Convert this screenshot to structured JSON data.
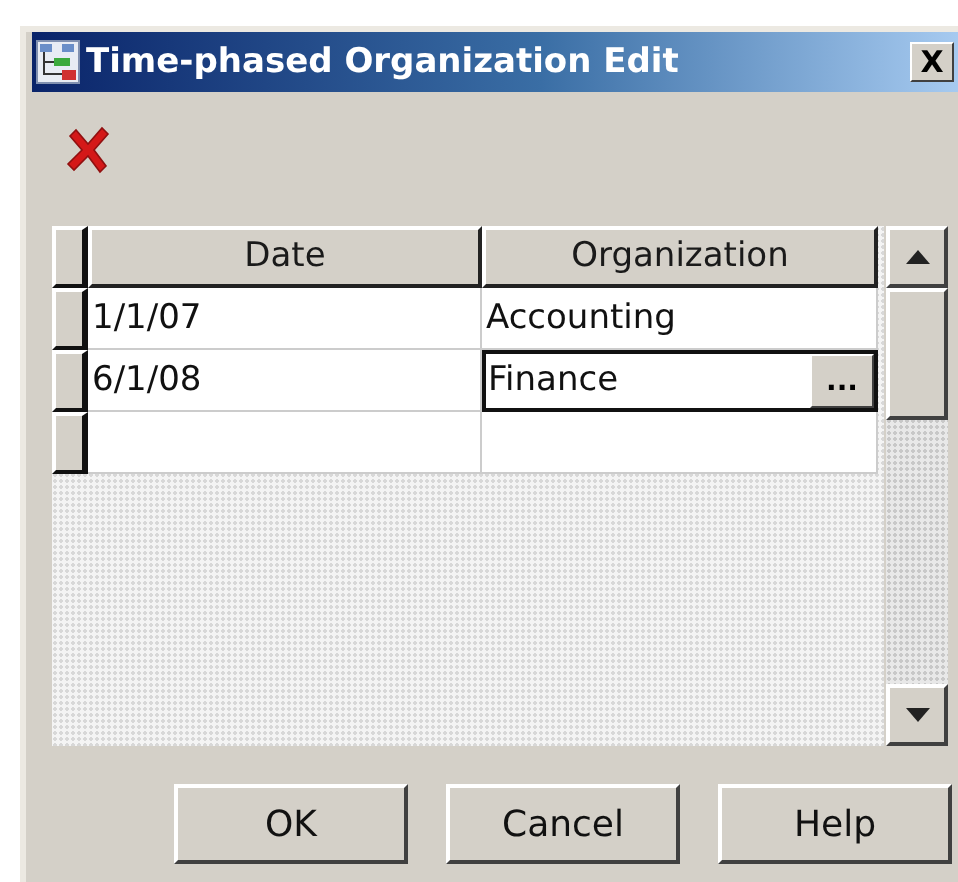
{
  "window": {
    "title": "Time-phased Organization Edit",
    "close_label": "X"
  },
  "table": {
    "columns": [
      "Date",
      "Organization"
    ],
    "editor_button": "...",
    "rows": [
      {
        "date": "1/1/07",
        "organization": "Accounting",
        "editing": false
      },
      {
        "date": "6/1/08",
        "organization": "Finance",
        "editing": true
      }
    ],
    "new_row": true
  },
  "buttons": [
    "OK",
    "Cancel",
    "Help"
  ]
}
